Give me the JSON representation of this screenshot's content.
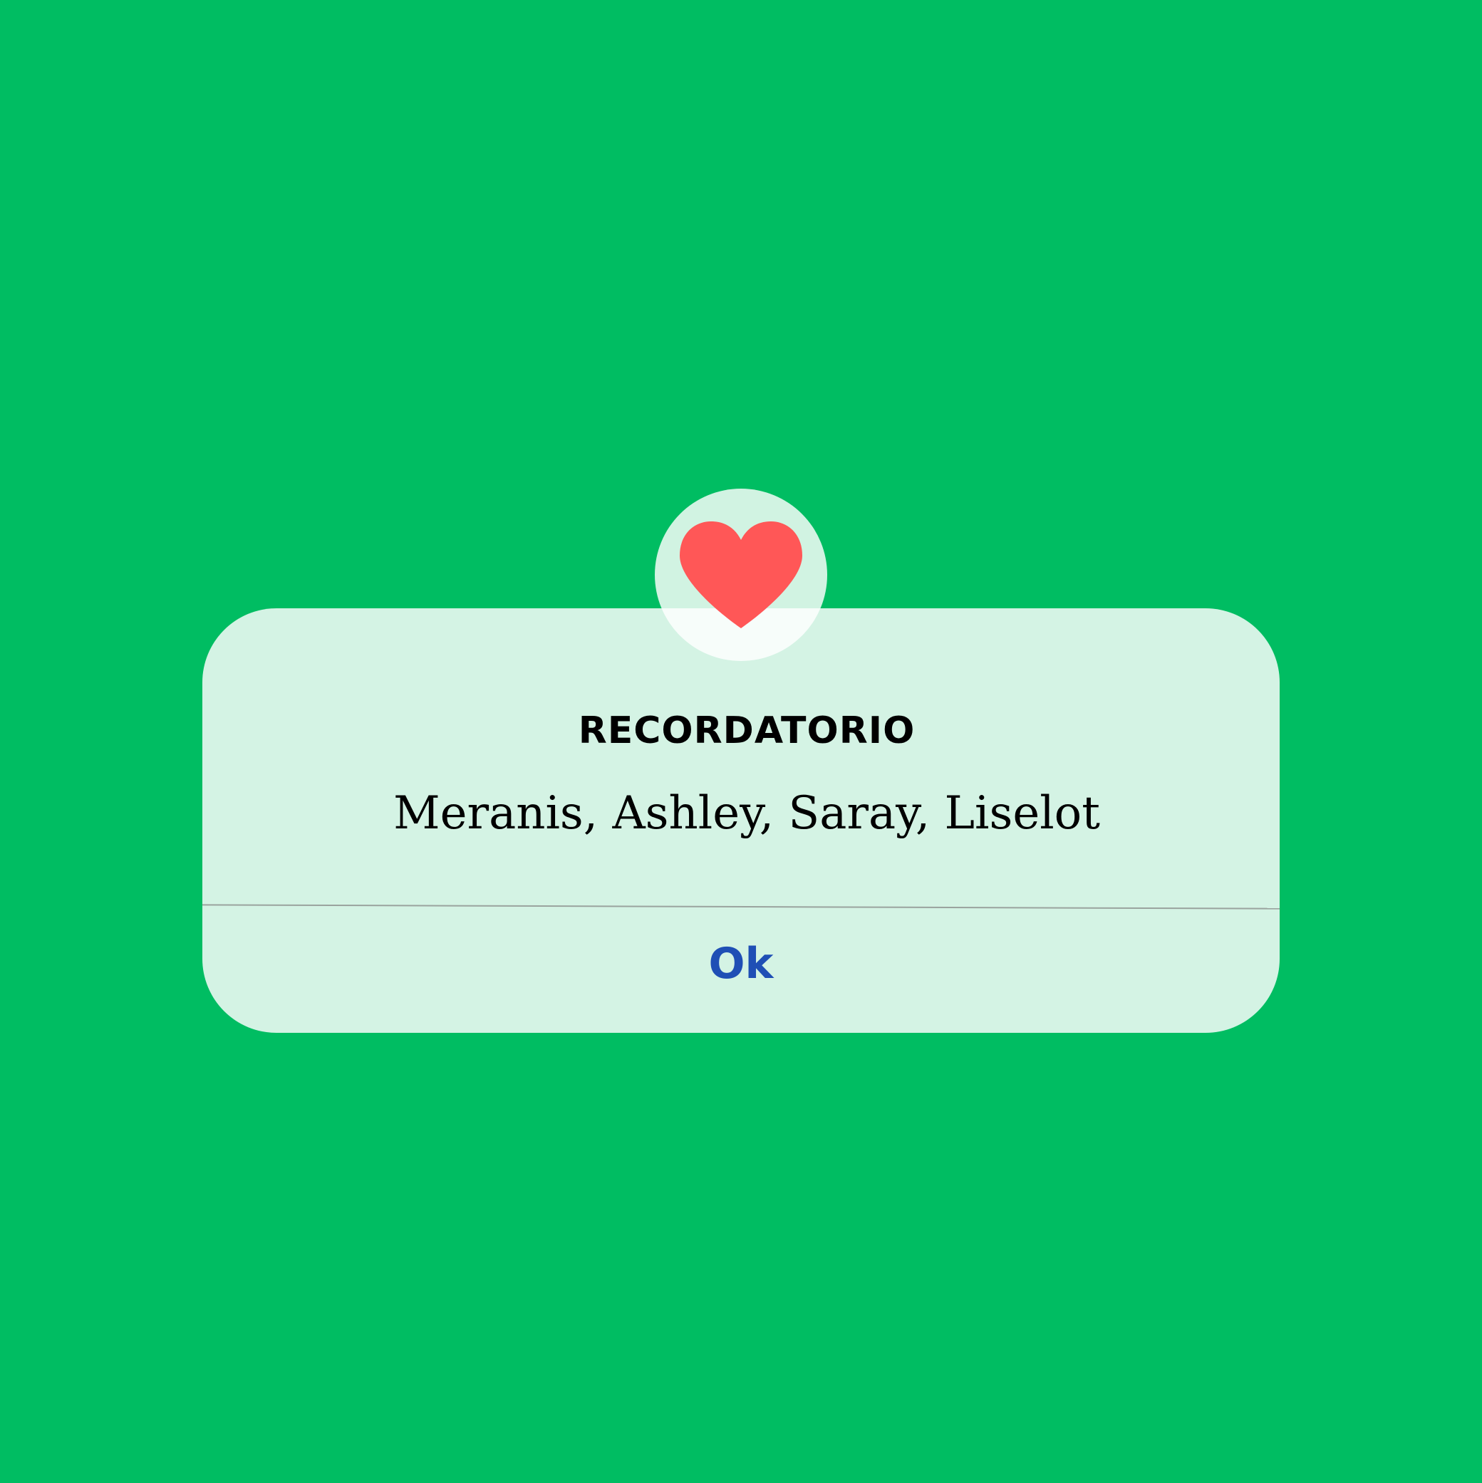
{
  "colors": {
    "background": "#00bd62",
    "dialog": "#d4f3e4",
    "heart": "#ff5757",
    "ok_text": "#1f4fb5"
  },
  "dialog": {
    "icon": "heart-icon",
    "title": "RECORDATORIO",
    "message": "Meranis, Ashley, Saray, Liselot",
    "ok_label": "Ok"
  }
}
